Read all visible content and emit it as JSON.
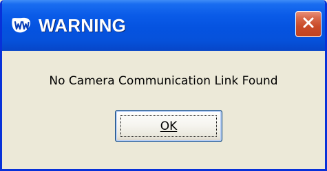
{
  "window": {
    "title": "WARNING",
    "icon": "app-logo-icon"
  },
  "controls": {
    "close_icon": "close-icon"
  },
  "dialog": {
    "message": "No Camera Communication Link Found",
    "ok_label": "OK"
  },
  "colors": {
    "titlebar": "#0553E0",
    "close_button": "#C94B29",
    "body": "#ECE9D8",
    "frame": "#0831D9"
  }
}
